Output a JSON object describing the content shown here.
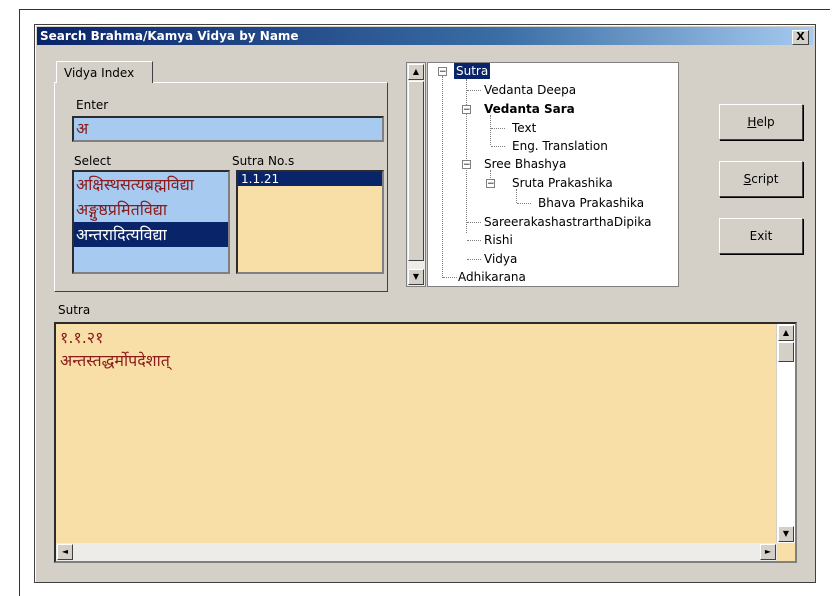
{
  "window": {
    "title": "Search Brahma/Kamya Vidya by Name",
    "close_label": "X"
  },
  "vidya_index": {
    "tab_label": "Vidya Index",
    "enter_label": "Enter",
    "enter_value": "अ",
    "select_label": "Select",
    "sutra_nos_label": "Sutra No.s",
    "select_items": [
      "अक्षिस्थसत्यब्रह्मविद्या",
      "अङ्गुष्ठप्रमितविद्या",
      "अन्तरादित्यविद्या"
    ],
    "selected_index": 2,
    "sutra_nos": [
      "1.1.21"
    ]
  },
  "tree": {
    "root": "Sutra",
    "items": [
      "Vedanta Deepa",
      "Vedanta Sara",
      "Text",
      "Eng. Translation",
      "Sree Bhashya",
      "Sruta Prakashika",
      "Bhava Prakashika",
      "SareerakashastrarthaDipika",
      "Rishi",
      "Vidya",
      "Adhikarana"
    ]
  },
  "buttons": {
    "help": "Help",
    "script": "Script",
    "exit": "Exit"
  },
  "sutra": {
    "label": "Sutra",
    "number": "१.१.२१",
    "text": "अन्तस्तद्धर्मोपदेशात्"
  },
  "colors": {
    "title_gradient_start": "#0a246a",
    "selection": "#0a246a",
    "list_blue": "#a6caf0",
    "list_tan": "#f8dfa8",
    "devanagari_text": "#8b1a1a"
  }
}
